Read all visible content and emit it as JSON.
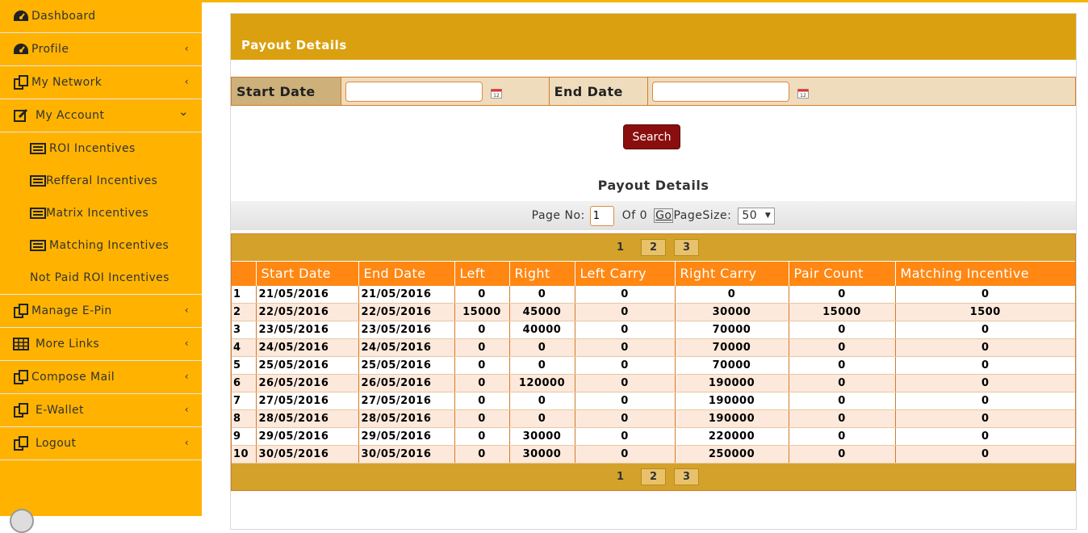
{
  "sidebar": {
    "items": [
      {
        "label": "Dashboard",
        "icon": "dashboard-icon",
        "chevron": false
      },
      {
        "label": "Profile",
        "icon": "dashboard-icon",
        "chevron": true
      },
      {
        "label": "My Network",
        "icon": "copy-icon",
        "chevron": true
      },
      {
        "label": "My Account",
        "icon": "edit-icon",
        "chevron": true,
        "expanded": true
      },
      {
        "label": "Manage E-Pin",
        "icon": "copy-icon",
        "chevron": true
      },
      {
        "label": "More Links",
        "icon": "table-icon",
        "chevron": true
      },
      {
        "label": "Compose Mail",
        "icon": "copy-icon",
        "chevron": true
      },
      {
        "label": "E-Wallet",
        "icon": "copy-icon",
        "chevron": true
      },
      {
        "label": "Logout",
        "icon": "copy-icon",
        "chevron": true
      }
    ],
    "subitems": [
      {
        "label": "ROI Incentives",
        "icon": "list-icon"
      },
      {
        "label": "Refferal Incentives",
        "icon": "list-icon"
      },
      {
        "label": "Matrix Incentives",
        "icon": "list-icon"
      },
      {
        "label": "Matching Incentives",
        "icon": "list-icon"
      },
      {
        "label": "Not Paid ROI Incentives",
        "icon": ""
      }
    ],
    "chevron_collapsed": "‹",
    "chevron_expanded": "⌄"
  },
  "panel": {
    "title": "Payout Details",
    "filters": {
      "start_label": "Start Date",
      "start_value": "",
      "end_label": "End Date",
      "end_value": ""
    },
    "search_label": "Search",
    "section_title": "Payout Details",
    "pager": {
      "page_no_label": "Page No:",
      "page_value": "1",
      "of_label": "Of 0",
      "go_label": "Go",
      "page_size_label": "PageSize:",
      "page_size_value": "50"
    },
    "page_links": [
      "1",
      "2",
      "3"
    ],
    "columns": [
      "",
      "Start Date",
      "End Date",
      "Left",
      "Right",
      "Left Carry",
      "Right Carry",
      "Pair Count",
      "Matching Incentive"
    ],
    "rows": [
      [
        "1",
        "21/05/2016",
        "21/05/2016",
        "0",
        "0",
        "0",
        "0",
        "0",
        "0"
      ],
      [
        "2",
        "22/05/2016",
        "22/05/2016",
        "15000",
        "45000",
        "0",
        "30000",
        "15000",
        "1500"
      ],
      [
        "3",
        "23/05/2016",
        "23/05/2016",
        "0",
        "40000",
        "0",
        "70000",
        "0",
        "0"
      ],
      [
        "4",
        "24/05/2016",
        "24/05/2016",
        "0",
        "0",
        "0",
        "70000",
        "0",
        "0"
      ],
      [
        "5",
        "25/05/2016",
        "25/05/2016",
        "0",
        "0",
        "0",
        "70000",
        "0",
        "0"
      ],
      [
        "6",
        "26/05/2016",
        "26/05/2016",
        "0",
        "120000",
        "0",
        "190000",
        "0",
        "0"
      ],
      [
        "7",
        "27/05/2016",
        "27/05/2016",
        "0",
        "0",
        "0",
        "190000",
        "0",
        "0"
      ],
      [
        "8",
        "28/05/2016",
        "28/05/2016",
        "0",
        "0",
        "0",
        "190000",
        "0",
        "0"
      ],
      [
        "9",
        "29/05/2016",
        "29/05/2016",
        "0",
        "30000",
        "0",
        "220000",
        "0",
        "0"
      ],
      [
        "10",
        "30/05/2016",
        "30/05/2016",
        "0",
        "30000",
        "0",
        "250000",
        "0",
        "0"
      ]
    ]
  },
  "colors": {
    "sidebar_bg": "#ffb300",
    "panel_header": "#daa010",
    "table_header": "#ff8712",
    "button": "#8b0e0e",
    "alt_row": "#fde9db"
  }
}
